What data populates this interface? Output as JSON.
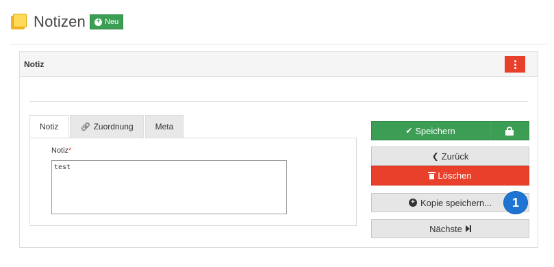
{
  "header": {
    "title": "Notizen",
    "new_button_label": "Neu",
    "icon": "sticky-note-icon"
  },
  "panel": {
    "title": "Notiz",
    "menu_icon": "vertical-ellipsis-icon"
  },
  "tabs": [
    {
      "label": "Notiz",
      "active": true
    },
    {
      "label": "Zuordnung",
      "icon": "link-icon"
    },
    {
      "label": "Meta"
    }
  ],
  "form": {
    "field_label": "Notiz",
    "required_marker": "*",
    "textarea_value": "test"
  },
  "actions": {
    "save_label": "Speichern",
    "back_label": "Zurück",
    "delete_label": "Löschen",
    "copy_label": "Kopie speichern...",
    "next_label": "Nächste"
  },
  "badge": {
    "number": "1"
  },
  "colors": {
    "success": "#3c9e54",
    "danger": "#e8402b",
    "badge": "#1f74d3",
    "panel_heading_bg": "#f5f5f5",
    "button_gray": "#e6e6e6"
  }
}
